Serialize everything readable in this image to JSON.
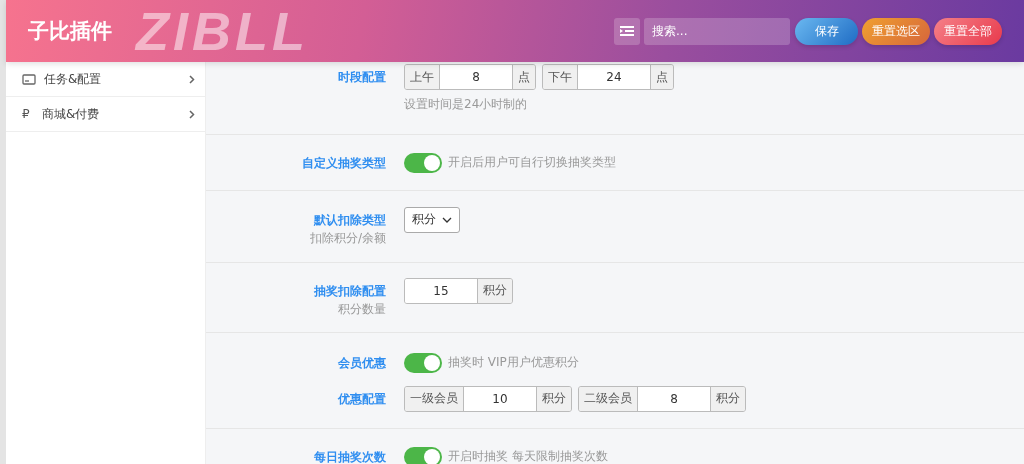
{
  "header": {
    "title": "子比插件",
    "watermark": "ZIBLL",
    "search": {
      "placeholder": "搜索..."
    },
    "buttons": [
      {
        "label": "保存",
        "kind": "save"
      },
      {
        "label": "重置选区",
        "kind": "reset-section"
      },
      {
        "label": "重置全部",
        "kind": "reset-all"
      }
    ]
  },
  "sidebar": {
    "items": [
      {
        "label": "任务&配置"
      },
      {
        "label": "商城&付费",
        "glyph": "₽"
      }
    ]
  },
  "rows": [
    {
      "lines": [
        {
          "label": "时段配置",
          "controls": [
            {
              "kind": "group",
              "parts": [
                {
                  "kind": "addon",
                  "text": "上午"
                },
                {
                  "kind": "input",
                  "value": "8"
                },
                {
                  "kind": "addon",
                  "text": "点"
                }
              ]
            },
            {
              "kind": "group",
              "parts": [
                {
                  "kind": "addon",
                  "text": "下午"
                },
                {
                  "kind": "input",
                  "value": "24"
                },
                {
                  "kind": "addon",
                  "text": "点"
                }
              ]
            }
          ]
        }
      ],
      "hint": "设置时间是24小时制的"
    },
    {
      "lines": [
        {
          "label": "自定义抽奖类型",
          "controls": [
            {
              "kind": "toggle",
              "on": true,
              "text": "开启后用户可自行切换抽奖类型"
            }
          ]
        }
      ]
    },
    {
      "lines": [
        {
          "label": "默认扣除类型",
          "sublabel": "扣除积分/余额",
          "controls": [
            {
              "kind": "select",
              "value": "积分"
            }
          ]
        }
      ]
    },
    {
      "lines": [
        {
          "label": "抽奖扣除配置",
          "sublabel": "积分数量",
          "controls": [
            {
              "kind": "group",
              "parts": [
                {
                  "kind": "input",
                  "value": "15"
                },
                {
                  "kind": "addon",
                  "text": "积分"
                }
              ]
            }
          ]
        }
      ]
    },
    {
      "lines": [
        {
          "label": "会员优惠",
          "controls": [
            {
              "kind": "toggle",
              "on": true,
              "text": "抽奖时 VIP用户优惠积分"
            }
          ]
        },
        {
          "label": "优惠配置",
          "controls": [
            {
              "kind": "group",
              "parts": [
                {
                  "kind": "addon",
                  "text": "一级会员"
                },
                {
                  "kind": "input",
                  "value": "10"
                },
                {
                  "kind": "addon",
                  "text": "积分"
                }
              ]
            },
            {
              "kind": "group",
              "parts": [
                {
                  "kind": "addon",
                  "text": "二级会员"
                },
                {
                  "kind": "input",
                  "value": "8"
                },
                {
                  "kind": "addon",
                  "text": "积分"
                }
              ]
            }
          ]
        }
      ]
    },
    {
      "lines": [
        {
          "label": "每日抽奖次数",
          "controls": [
            {
              "kind": "toggle",
              "on": true,
              "text": "开启时抽奖 每天限制抽奖次数"
            }
          ]
        }
      ]
    }
  ]
}
